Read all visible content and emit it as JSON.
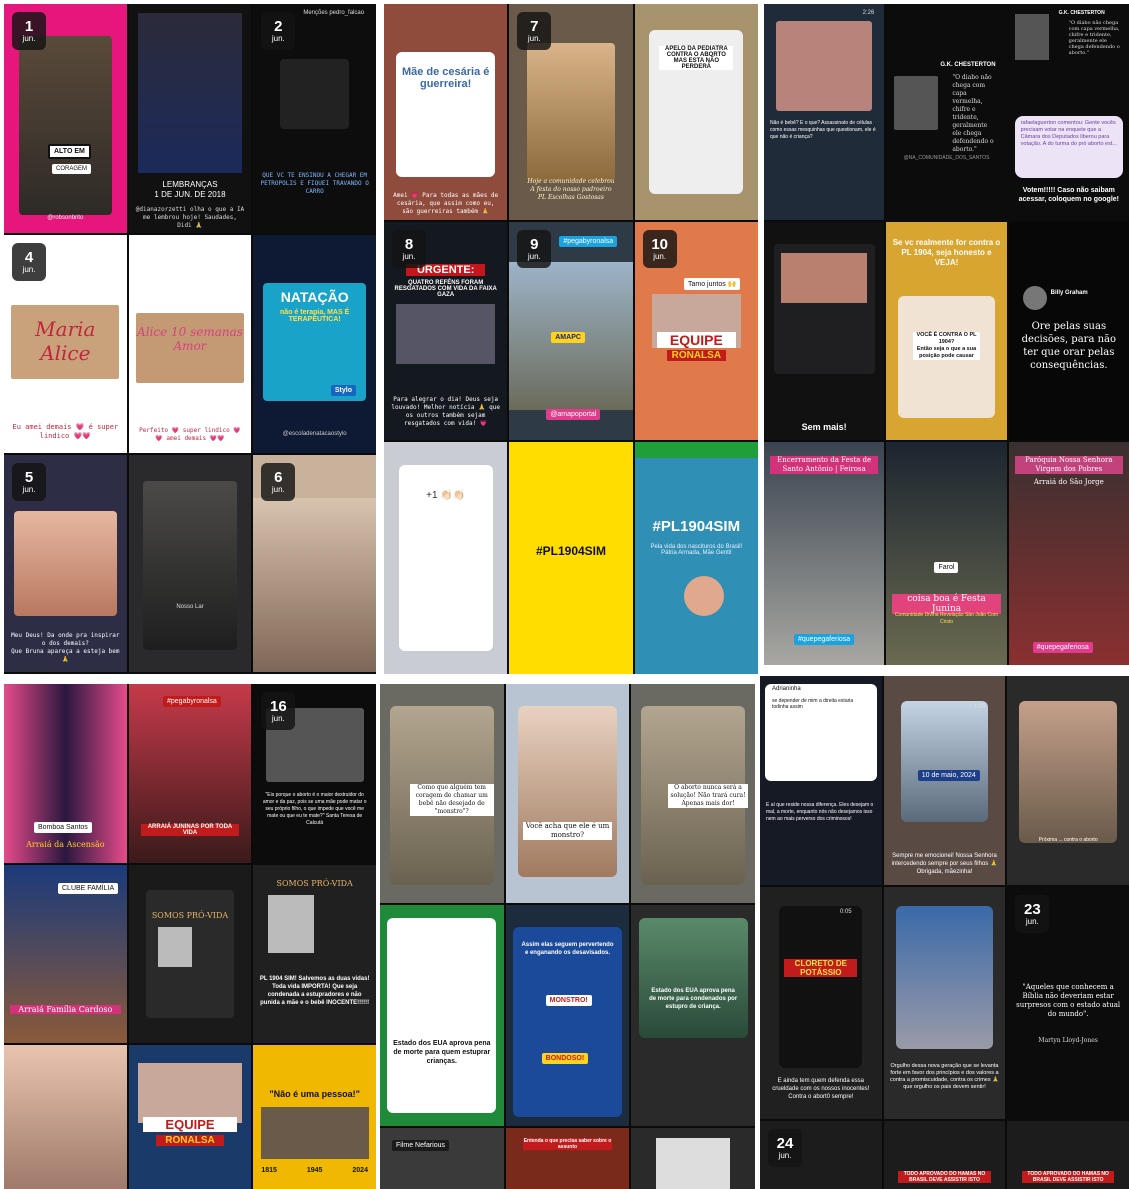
{
  "panel1": {
    "jun1": {
      "day": "1",
      "month": "jun.",
      "sign": "ALTO EM",
      "sign2": "CORAGEM",
      "handle": "@robsonbrito"
    },
    "t2": {
      "caption": "LEMBRANÇAS\n1 DE JUN. DE 2018",
      "text": "@dianazorzetti olha o que a IA me lembrou hoje!\nSaudades, Didi 🙏"
    },
    "jun2": {
      "day": "2",
      "month": "jun.",
      "handle": "Menções pedro_falcao",
      "caption": "QUE VC TE ENSINOU A CHEGAR EM PETROPOLIS E FIQUEI TRAVANDO O CARRO"
    },
    "jun4": {
      "day": "4",
      "month": "jun.",
      "sign": "Maria Alice",
      "caption": "Eu amei demais 💗 é super lindico 💗💗"
    },
    "t5": {
      "sign": "Alice 10 semanas Amor",
      "caption": "Perfeito 💗 super lindico 💗\n💗 amei demais 💗💗"
    },
    "t6": {
      "title": "NATAÇÃO",
      "sub": "não é terapia, MAS É TERAPÊUTICA!",
      "brand": "Stylo",
      "handle": "@escoladenatacaostylo"
    },
    "jun5": {
      "day": "5",
      "month": "jun.",
      "caption": "Meu Deus! Da onde pra inspirar o dos demais?\nQue Bruna apareça a esteja bem 🙏"
    },
    "t8": {
      "label": "Nosso Lar"
    },
    "jun6": {
      "day": "6",
      "month": "jun."
    }
  },
  "panel2": {
    "t1": {
      "title": "Mãe de cesária é guerreira!",
      "caption": "Amei 💗 Para todas as mães de cesária, que assim como eu, são guerreiras também 🙏"
    },
    "jun7": {
      "day": "7",
      "month": "jun.",
      "caption": "Hoje a comunidade celebrou\nA festa do nosso padroeiro\nPL Escolhas Gostosas"
    },
    "t3": {
      "title": "APELO DA PEDIATRA CONTRA O ABORTO MAS ESTA NÃO PERDERÁ"
    },
    "jun8": {
      "day": "8",
      "month": "jun.",
      "title": "URGENTE:",
      "sub": "QUATRO REFÉNS FORAM RESGATADOS COM VIDA DA FAIXA GAZA",
      "caption": "Para alegrar o dia! Deus seja louvado! Melhor notícia 🙏 que os outros também sejam resgatados com vida! 💗"
    },
    "jun9": {
      "day": "9",
      "month": "jun.",
      "hashtag": "#pegabyronalsa",
      "banner": "AMAPC",
      "handle": "@amapoportal"
    },
    "jun10": {
      "day": "10",
      "month": "jun.",
      "sub": "Tamo juntos 🙌",
      "title": "EQUIPE",
      "title2": "RONALSA"
    },
    "t7": {
      "label": "+1 👏🏻👏🏻"
    },
    "t8": {
      "hashtag": "#PL1904SIM"
    },
    "t9": {
      "hashtag": "#PL1904SIM",
      "sub": "Pela vida dos nascituros do Brasil!\nPátria Armada, Mãe Gentil"
    }
  },
  "panel3": {
    "t1": {
      "time": "2:26",
      "caption": "Não é bebê? E o que? Assassinato de células como essas mesquinhas que questionam, ele é que não é criança?"
    },
    "t2": {
      "name": "G.K. CHESTERTON",
      "quote": "\"O diabo não chega com capa vermelha, chifre e tridente, geralmente ele chega defendendo o aborto.\"",
      "handle": "@NA_COMUNIDADE_DOS_SANTOS"
    },
    "t3": {
      "name": "G.K. CHESTERTON",
      "quote": "\"O diabo não chega com capa vermelha, chifre e tridente, geralmente ele chega defendendo o aborto.\"",
      "comment": "rafaelaguerton comentou: Gente vocês precisam votar na enquete que a Câmara dos Deputados liberou para votação. A do turma do pró aborto est...",
      "caption": "Votem!!!!! Caso não saibam acessar, coloquem no google!"
    },
    "t4": {
      "caption": "Sem mais!"
    },
    "t5": {
      "title": "Se vc realmente for contra o PL 1904, seja honesto e VEJA!",
      "box": "VOCÊ É CONTRA O PL 1904?\nEntão seja o que a sua posição pode causar"
    },
    "t6": {
      "name": "Billy Graham",
      "quote": "Ore pelas suas decisões, para não ter que orar pelas consequências."
    },
    "t7": {
      "title": "Encerramento da Festa de Santo Antônio | Feirosa",
      "hashtag": "#quepegaferiosa"
    },
    "t8": {
      "label": "Farol",
      "caption": "coisa boa é Festa Junina",
      "sub": "Comunidade Divina Revelação São João Com Cristo"
    },
    "t9": {
      "title": "Paróquia Nossa Senhora Virgem dos Pobres",
      "sub": "Arraiá do São Jorge",
      "hashtag": "#quepegaferiosa"
    }
  },
  "panel4": {
    "t1": {
      "tag": "Bomboa Santos",
      "caption": "Arraiá da Ascensão"
    },
    "t2": {
      "caption": "ARRAIÁ JUNINAS POR TODA VIDA",
      "hashtag": "#pegabyronalsa"
    },
    "jun16": {
      "day": "16",
      "month": "jun.",
      "caption": "\"Eis porque o aborto é o maior destruidor do amor e da paz, pois se uma mãe pode matar o seu próprio filho, o que impede que você me mate ou que eu te mate?\" Santa Teresa de Calcutá"
    },
    "t4": {
      "caption": "Arraiá Família Cardoso",
      "tag": "CLUBE FAMÍLIA"
    },
    "t5": {
      "title": "SOMOS PRÓ-VIDA"
    },
    "t6": {
      "title": "SOMOS PRÓ-VIDA",
      "caption": "PL 1904 SIM! Salvemos as duas vidas! Toda vida IMPORTA! Que seja condenada a estupradores e não punida a mãe e o bebê INOCENTE!!!!!!"
    },
    "t8": {
      "title": "EQUIPE",
      "title2": "RONALSA"
    },
    "t9": {
      "title": "\"Não é uma pessoa!\"",
      "years": [
        "1815",
        "1945",
        "2024"
      ]
    }
  },
  "panel5": {
    "t1": {
      "caption": "Como que alguém tem coragem de chamar um bebê não desejado de \"monstro\"?"
    },
    "t2": {
      "caption": "Você acha que ele é um monstro?"
    },
    "t3": {
      "caption": "O aborto nunca será a solução! Não trará cura! Apenas mais dor!"
    },
    "t4": {
      "title": "Estado dos EUA aprova pena de morte para quem estuprar crianças."
    },
    "t5": {
      "title": "Assim elas seguem pervertendo e enganando os desavisados.",
      "tag1": "MONSTRO!",
      "tag2": "BONDOSO!"
    },
    "t6": {
      "title": "Estado dos EUA aprova pena de morte para condenados por estupro de criança."
    },
    "t7": {
      "label": "Filme Nefarious"
    },
    "t8": {
      "title": "Entenda o que precisa saber sobre o assunto"
    }
  },
  "panel6": {
    "t1": {
      "handle": "Adrianinha",
      "quote": "se depender de mim a direita estaria todinha assim",
      "caption": "E aí que reside nossa diferença. Eles desejam o mal, a morte, enquanto nós não desejamos isso nem ao mais perverso dos criminosos!"
    },
    "t2": {
      "time": "1:18",
      "date": "10 de maio, 2024",
      "caption": "Sempre me emocionei! Nossa Senhora intercedendo sempre por seus filhos 🙏 Obrigada, mãezinha!"
    },
    "t3": {
      "caption": "Próxima ... contra o aborto"
    },
    "t4": {
      "time": "0:05",
      "title": "CLORETO DE POTÁSSIO",
      "caption": "E ainda tem quem defenda essa crueldade com os nossos inocentes! Contra o abort0 sempre!"
    },
    "t5": {
      "caption": "Orgulho dessa nova geração que se levanta forte em favor dos princípios e dos valores a contra a promiscuidade, contra os crimes 🙏 que orgulho os pais devem sentir!"
    },
    "jun23": {
      "day": "23",
      "month": "jun.",
      "quote": "\"Aqueles que conhecem a Bíblia não deveriam estar surpresos com o estado atual do mundo\".",
      "name": "Martyn Lloyd-Jones"
    },
    "jun24": {
      "day": "24",
      "month": "jun."
    },
    "t9": {
      "title": "TODO APROVADO DO HAMAS NO BRASIL DEVE ASSISTIR ISTO"
    }
  }
}
